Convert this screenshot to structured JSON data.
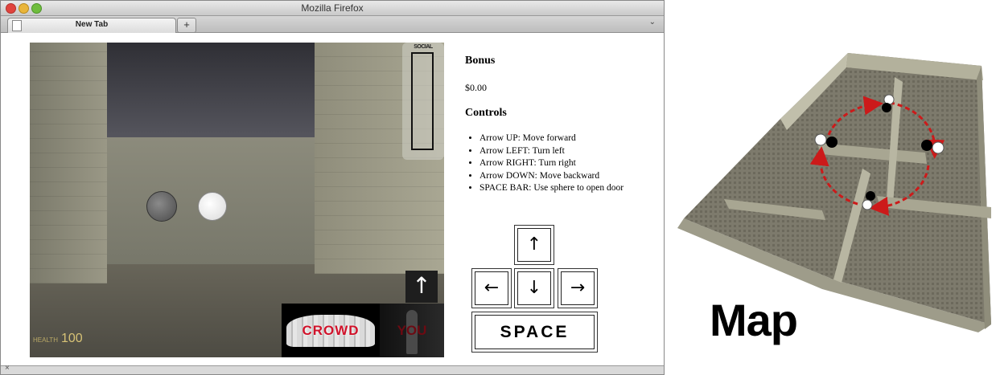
{
  "window": {
    "title": "Mozilla Firefox"
  },
  "tabs": [
    {
      "label": "New Tab"
    }
  ],
  "new_tab": "+",
  "tab_menu": "⌄",
  "statusbar": {
    "close": "×"
  },
  "game": {
    "minimap_label": "SOCIAL",
    "health_small": "HEALTH",
    "health_value": "100",
    "hud_arrow": "↑",
    "crowd_label": "CROWD",
    "you_label": "YOU"
  },
  "side": {
    "bonus_heading": "Bonus",
    "bonus_value": "$0.00",
    "controls_heading": "Controls",
    "controls": [
      "Arrow UP: Move forward",
      "Arrow LEFT: Turn left",
      "Arrow RIGHT: Turn right",
      "Arrow DOWN: Move backward",
      "SPACE BAR: Use sphere to open door"
    ]
  },
  "keys": {
    "up": "↑",
    "left": "←",
    "down": "↓",
    "right": "→",
    "space": "SPACE"
  },
  "map": {
    "title": "Map"
  },
  "colors": {
    "crowd_red": "#d0122a",
    "arrow_red": "#cc1a1a",
    "health": "#d7c276"
  }
}
